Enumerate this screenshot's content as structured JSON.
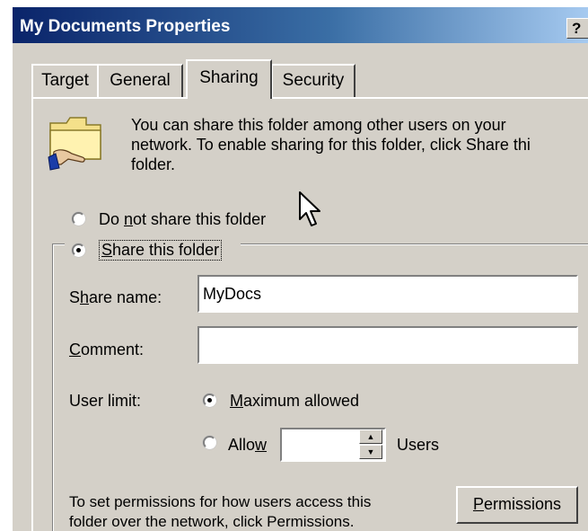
{
  "window": {
    "title": "My Documents Properties",
    "help_label": "?"
  },
  "tabs": [
    {
      "label": "Target",
      "selected": false
    },
    {
      "label": "General",
      "selected": false
    },
    {
      "label": "Sharing",
      "selected": true
    },
    {
      "label": "Security",
      "selected": false
    }
  ],
  "intro": {
    "icon": "shared-folder-icon",
    "line1": "You can share this folder among other users on your",
    "line2": "network.  To enable sharing for this folder, click Share thi",
    "line3": "folder."
  },
  "sharing_options": {
    "no_share": {
      "pre": "Do ",
      "accel": "n",
      "post": "ot share this folder",
      "checked": false
    },
    "share": {
      "pre": "",
      "accel": "S",
      "post": "hare this folder",
      "checked": true
    }
  },
  "share_name": {
    "pre": "S",
    "accel": "h",
    "post": "are name:",
    "value": "MyDocs"
  },
  "comment": {
    "pre": "",
    "accel": "C",
    "post": "omment:",
    "value": ""
  },
  "user_limit": {
    "label": "User limit:",
    "maximum": {
      "pre": "",
      "accel": "M",
      "post": "aximum allowed",
      "checked": true
    },
    "allow": {
      "pre": "Allo",
      "accel": "w",
      "post": "",
      "checked": false,
      "value": ""
    },
    "users_label": "Users"
  },
  "permissions": {
    "line1": "To set permissions for how users access this",
    "line2": "folder over the network, click Permissions.",
    "button": {
      "pre": "",
      "accel": "P",
      "post": "ermissions"
    }
  },
  "colors": {
    "dialog_bg": "#d4d0c8",
    "title_start": "#0a246a",
    "title_end": "#a6caf0"
  }
}
